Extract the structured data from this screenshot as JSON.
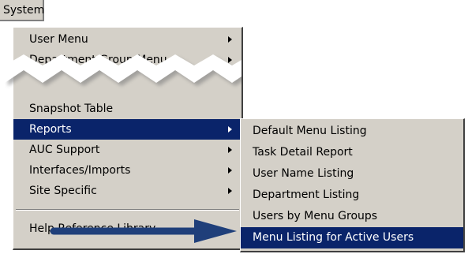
{
  "menubar": {
    "system_label": "System"
  },
  "main_menu": {
    "items": [
      {
        "label": "User Menu"
      },
      {
        "label": "Department Group Menu"
      },
      {
        "label": "Snapshot Table"
      },
      {
        "label": "Reports"
      },
      {
        "label": "AUC Support"
      },
      {
        "label": "Interfaces/Imports"
      },
      {
        "label": "Site Specific"
      },
      {
        "label": "Help Reference Library"
      }
    ]
  },
  "sub_menu": {
    "items": [
      {
        "label": "Default Menu Listing"
      },
      {
        "label": "Task Detail Report"
      },
      {
        "label": "User Name Listing"
      },
      {
        "label": "Department Listing"
      },
      {
        "label": "Users by Menu Groups"
      },
      {
        "label": "Menu Listing for Active Users"
      }
    ]
  },
  "colors": {
    "menu_bg": "#d4d0c8",
    "highlight": "#0a246a",
    "pointer_arrow": "#1f3f7a"
  }
}
